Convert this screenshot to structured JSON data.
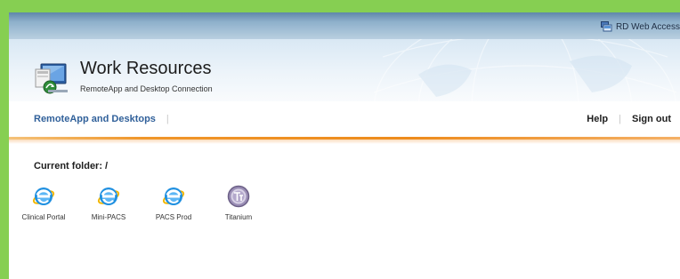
{
  "topbar": {
    "rd_web_access_label": "RD Web Access"
  },
  "header": {
    "title": "Work Resources",
    "subtitle": "RemoteApp and Desktop Connection"
  },
  "nav": {
    "remoteapp_desktops": "RemoteApp and Desktops",
    "separator": "|",
    "help": "Help",
    "sign_out": "Sign out"
  },
  "folder": {
    "current_folder_label": "Current folder: /"
  },
  "apps": [
    {
      "label": "Clinical Portal",
      "icon": "internet-explorer-icon"
    },
    {
      "label": "Mini-PACS",
      "icon": "internet-explorer-icon"
    },
    {
      "label": "PACS Prod",
      "icon": "internet-explorer-icon"
    },
    {
      "label": "Titanium",
      "icon": "titanium-icon"
    }
  ],
  "colors": {
    "frame_border": "#86cf52",
    "nav_link": "#30609a",
    "accent_orange": "#f0962a",
    "ie_blue": "#1e8fe0"
  }
}
